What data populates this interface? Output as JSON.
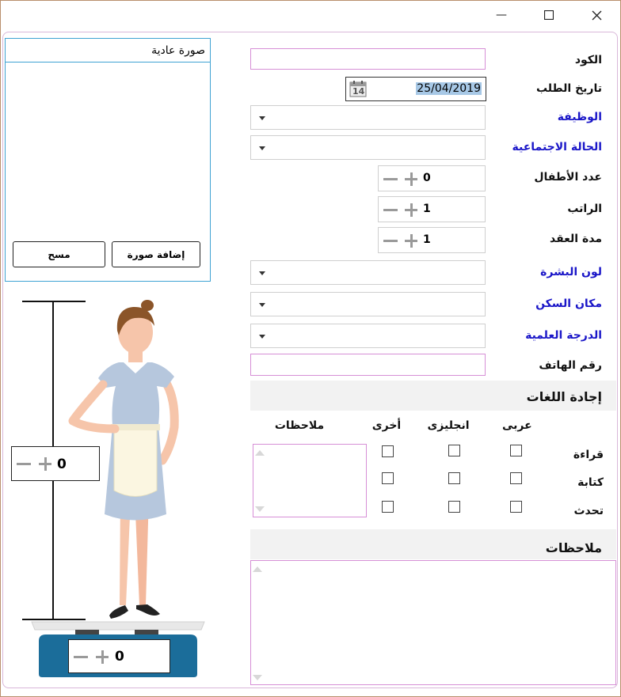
{
  "window": {
    "minimize_glyph": "—",
    "maximize_glyph": "☐",
    "close_glyph": "✕"
  },
  "form": {
    "code_label": "الكود",
    "order_date_label": "تاريخ الطلب",
    "order_date_value": "25/04/2019",
    "calendar_day": "14",
    "job_label": "الوظيفة",
    "marital_label": "الحالة الاجتماعية",
    "children_label": "عدد الأطفال",
    "children_value": "0",
    "salary_label": "الراتب",
    "salary_value": "1",
    "contract_label": "مدة العقد",
    "contract_value": "1",
    "skin_label": "لون البشرة",
    "residence_label": "مكان السكن",
    "degree_label": "الدرجة العلمية",
    "phone_label": "رقم الهاتف"
  },
  "languages": {
    "title": "إجادة اللغات",
    "col_arabic": "عربى",
    "col_english": "انجليزى",
    "col_other": "أخرى",
    "col_notes": "ملاحظات",
    "row_reading": "قراءة",
    "row_writing": "كتابة",
    "row_speaking": "تحدث"
  },
  "notes": {
    "title": "ملاحظات"
  },
  "photo": {
    "title": "صورة عادية",
    "add_button": "إضافة صورة",
    "clear_button": "مسح"
  },
  "measure": {
    "height_value": "0",
    "weight_value": "0"
  },
  "colors": {
    "label_blue": "#1a16c8",
    "input_border": "#d68fd6",
    "scale_blue": "#1b6d9a",
    "uniform": "#b6c7dd",
    "apron": "#fbf6e1"
  }
}
